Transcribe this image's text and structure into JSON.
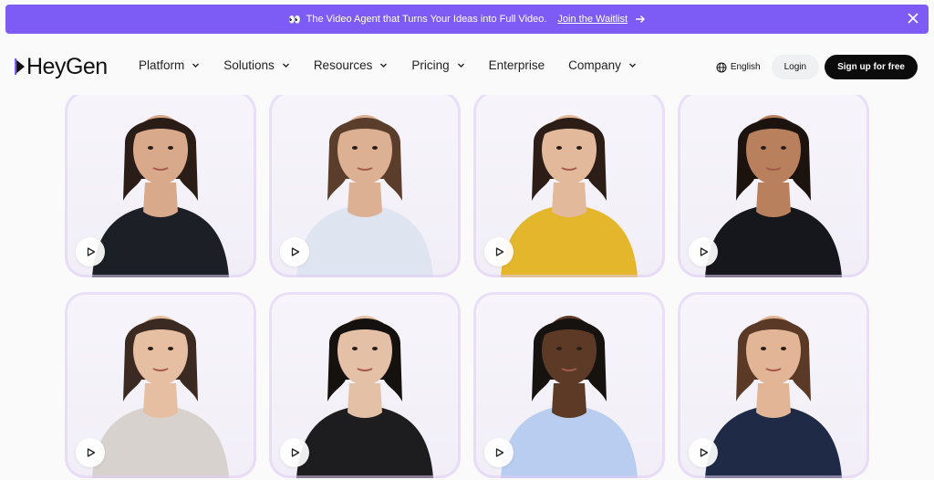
{
  "banner": {
    "emoji": "👀",
    "text": "The Video Agent that Turns Your Ideas into Full Video.",
    "link": "Join the Waitlist",
    "bg_color": "#7c5cf5"
  },
  "brand": {
    "name": "HeyGen"
  },
  "nav": {
    "items": [
      {
        "label": "Platform",
        "dropdown": true
      },
      {
        "label": "Solutions",
        "dropdown": true
      },
      {
        "label": "Resources",
        "dropdown": true
      },
      {
        "label": "Pricing",
        "dropdown": true
      },
      {
        "label": "Enterprise",
        "dropdown": false
      },
      {
        "label": "Company",
        "dropdown": true
      }
    ]
  },
  "header_right": {
    "language": "English",
    "login": "Login",
    "signup": "Sign up for free"
  },
  "avatars": [
    {
      "icon": "play-icon",
      "outfit_color": "#1c1f26",
      "hair_color": "#2a1d17",
      "skin": "#d9a98b"
    },
    {
      "icon": "play-icon",
      "outfit_color": "#dfe5f0",
      "hair_color": "#5a3e2b",
      "skin": "#dcb093"
    },
    {
      "icon": "play-icon",
      "outfit_color": "#e4b62c",
      "hair_color": "#2c1e16",
      "skin": "#e3b99c"
    },
    {
      "icon": "play-icon",
      "outfit_color": "#15171c",
      "hair_color": "#1c130f",
      "skin": "#b9805e"
    },
    {
      "icon": "play-icon",
      "outfit_color": "#d8d2cf",
      "hair_color": "#3a2a21",
      "skin": "#e6bfa3"
    },
    {
      "icon": "play-icon",
      "outfit_color": "#1d1d1f",
      "hair_color": "#15110f",
      "skin": "#e4c0a6"
    },
    {
      "icon": "play-icon",
      "outfit_color": "#b8cdf0",
      "hair_color": "#161210",
      "skin": "#5c3a26"
    },
    {
      "icon": "play-icon",
      "outfit_color": "#1e2a46",
      "hair_color": "#5a3a27",
      "skin": "#e2b596"
    }
  ]
}
